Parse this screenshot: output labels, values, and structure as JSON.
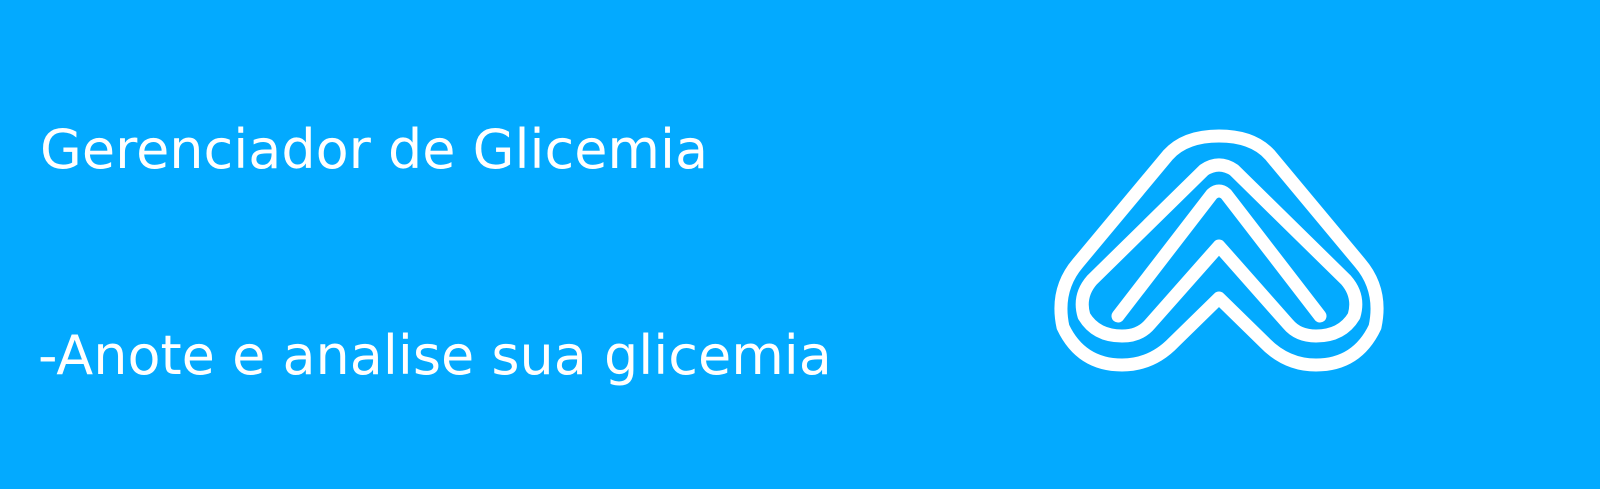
{
  "header": {
    "title": "Gerenciador de Glicemia",
    "subtitle": "-Anote e analise sua glicemia"
  },
  "logo": {
    "icon": "chevron-up-rings-icon"
  },
  "colors": {
    "background": "#03aaff",
    "foreground": "#ffffff"
  }
}
